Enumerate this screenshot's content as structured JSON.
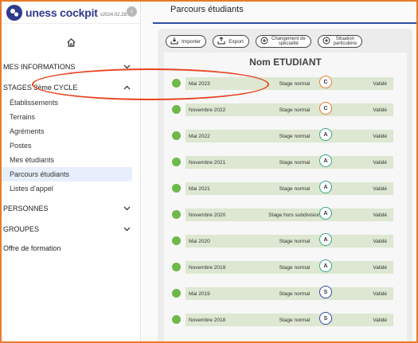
{
  "app": {
    "title": "uness cockpit",
    "version": "v2024.02.28.0"
  },
  "sidebar": {
    "sections": [
      {
        "label": "MES INFORMATIONS",
        "chevron": "⌄"
      },
      {
        "label": "STAGES 3ème CYCLE",
        "chevron": "⌃"
      },
      {
        "label": "PERSONNES",
        "chevron": "⌄"
      },
      {
        "label": "GROUPES",
        "chevron": "⌄"
      }
    ],
    "stage_items": [
      "Établissements",
      "Terrains",
      "Agréments",
      "Postes",
      "Mes étudiants",
      "Parcours étudiants",
      "Listes d'appel"
    ],
    "offer": "Offre de formation",
    "active_item": "Parcours étudiants"
  },
  "header": {
    "title": "Parcours étudiants"
  },
  "toolbar": {
    "import": "Importer",
    "export": "Export",
    "change_specialty_1": "Changement de",
    "change_specialty_2": "spécialité",
    "situation_1": "Situation",
    "situation_2": "particulière"
  },
  "student": {
    "name": "Nom ETUDIANT"
  },
  "stages": [
    {
      "date": "Mai 2023",
      "type": "Stage normal",
      "grade": "C",
      "status": "Validé"
    },
    {
      "date": "Novembre 2022",
      "type": "Stage normal",
      "grade": "C",
      "status": "Validé"
    },
    {
      "date": "Mai 2022",
      "type": "Stage normal",
      "grade": "A",
      "status": "Validé"
    },
    {
      "date": "Novembre 2021",
      "type": "Stage normal",
      "grade": "A",
      "status": "Validé"
    },
    {
      "date": "Mai 2021",
      "type": "Stage normal",
      "grade": "A",
      "status": "Validé"
    },
    {
      "date": "Novembre 2020",
      "type": "Stage hors subdivision",
      "grade": "A",
      "status": "Validé"
    },
    {
      "date": "Mai 2020",
      "type": "Stage normal",
      "grade": "A",
      "status": "Validé"
    },
    {
      "date": "Novembre 2019",
      "type": "Stage normal",
      "grade": "A",
      "status": "Validé"
    },
    {
      "date": "Mai 2019",
      "type": "Stage normal",
      "grade": "S",
      "status": "Validé"
    },
    {
      "date": "Novembre 2018",
      "type": "Stage normal",
      "grade": "S",
      "status": "Validé"
    }
  ],
  "colors": {
    "brand": "#2e3a8c",
    "accent": "#2e4fa8",
    "highlight": "#e8431f",
    "valid_dot": "#6fb84a"
  },
  "icons": [
    "uness-logo-icon",
    "collapse-icon",
    "home-icon",
    "chevron-down-icon",
    "chevron-up-icon",
    "menu-handle-icon",
    "import-icon",
    "export-icon",
    "plus-circle-icon"
  ]
}
